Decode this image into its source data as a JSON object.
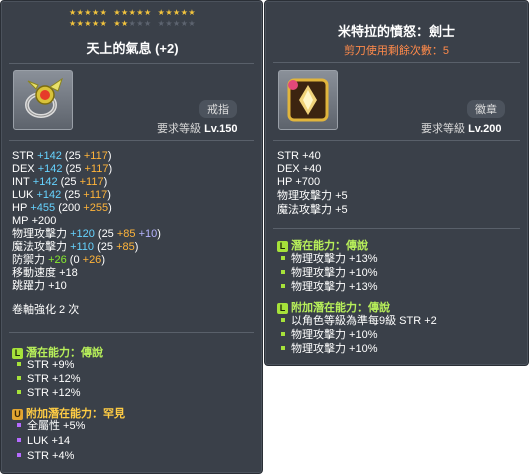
{
  "left": {
    "stars_row1": [
      "★★★★★",
      "★★★★★",
      "★★★★★"
    ],
    "stars_row2_on": [
      "★★★★★",
      "★★"
    ],
    "stars_row2_off": "★★★",
    "stars_row2_off2": "★★★★★",
    "title": "天上的氣息 (+2)",
    "type": "戒指",
    "req_label": "要求等級",
    "req_level": "Lv.150",
    "stats": [
      {
        "name": "STR",
        "total": "+142",
        "base": "(25",
        "bonus": "+117",
        "close": ")"
      },
      {
        "name": "DEX",
        "total": "+142",
        "base": "(25",
        "bonus": "+117",
        "close": ")"
      },
      {
        "name": "INT",
        "total": "+142",
        "base": "(25",
        "bonus": "+117",
        "close": ")"
      },
      {
        "name": "LUK",
        "total": "+142",
        "base": "(25",
        "bonus": "+117",
        "close": ")"
      },
      {
        "name": "HP",
        "total": "+455",
        "base": "(200",
        "bonus": "+255",
        "close": ")"
      }
    ],
    "mp": {
      "name": "MP",
      "value": "+200"
    },
    "atk": {
      "name": "物理攻擊力",
      "total": "+120",
      "base": "(25",
      "bonus": "+85",
      "extra": "+10",
      "close": ")"
    },
    "matk": {
      "name": "魔法攻擊力",
      "total": "+110",
      "base": "(25",
      "bonus": "+85",
      "close": ")"
    },
    "def": {
      "name": "防禦力",
      "total": "+26",
      "base": "(0",
      "bonus": "+26",
      "close": ")"
    },
    "speed": {
      "name": "移動速度",
      "value": "+18"
    },
    "jump": {
      "name": "跳躍力",
      "value": "+10"
    },
    "scroll": "卷軸強化 2 次",
    "potential_title": "潛在能力：傳說",
    "potential_badge": "L",
    "potential": [
      "STR +9%",
      "STR +12%",
      "STR +12%"
    ],
    "bonus_title": "附加潛在能力：罕見",
    "bonus_badge": "U",
    "bonus": [
      "全屬性 +5%",
      "LUK +14",
      "STR +4%"
    ]
  },
  "right": {
    "title": "米特拉的憤怒：劍士",
    "subtitle": "剪刀使用剩餘次數：5",
    "type": "徽章",
    "req_label": "要求等級",
    "req_level": "Lv.200",
    "stats": [
      {
        "name": "STR",
        "value": "+40"
      },
      {
        "name": "DEX",
        "value": "+40"
      },
      {
        "name": "HP",
        "value": "+700"
      },
      {
        "name": "物理攻擊力",
        "value": "+5"
      },
      {
        "name": "魔法攻擊力",
        "value": "+5"
      }
    ],
    "potential_title": "潛在能力：傳說",
    "potential_badge": "L",
    "potential": [
      "物理攻擊力 +13%",
      "物理攻擊力 +10%",
      "物理攻擊力 +13%"
    ],
    "bonus_title": "附加潛在能力：傳說",
    "bonus_badge": "L",
    "bonus": [
      "以角色等級為準每9級 STR +2",
      "物理攻擊力 +10%",
      "物理攻擊力 +10%"
    ]
  },
  "colors": {
    "panel": "#3a4049",
    "stat_blue": "#66d3ff",
    "stat_orange": "#ffb43a",
    "stat_green": "#86ea2e",
    "legendary": "#a6e23a",
    "unique": "#e2a531"
  },
  "icons": {
    "left_item": "ring-icon",
    "right_item": "emblem-icon"
  }
}
